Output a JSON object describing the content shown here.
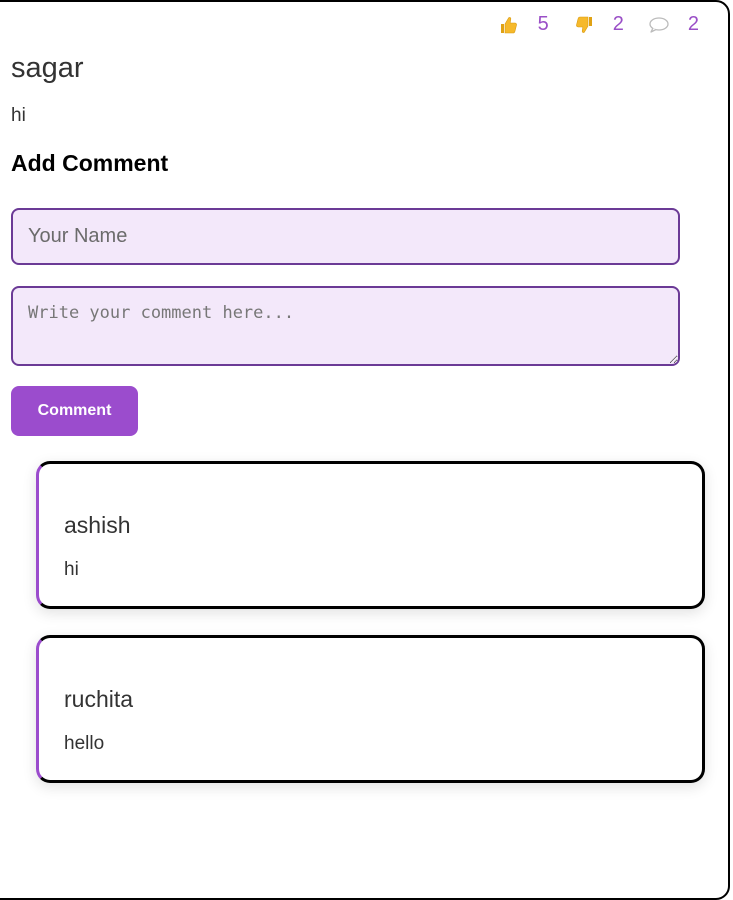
{
  "post": {
    "author": "sagar",
    "text": "hi",
    "reactions": {
      "likes": "5",
      "dislikes": "2",
      "comments": "2",
      "like_icon": "thumbs-up-icon",
      "dislike_icon": "thumbs-down-icon",
      "comment_icon": "speech-bubble-icon"
    }
  },
  "form": {
    "title": "Add Comment",
    "name_placeholder": "Your Name",
    "name_value": "",
    "comment_placeholder": "Write your comment here...",
    "comment_value": "",
    "submit_label": "Comment"
  },
  "comments": [
    {
      "author": "ashish",
      "text": "hi"
    },
    {
      "author": "ruchita",
      "text": "hello"
    }
  ],
  "colors": {
    "accent": "#9b4ccd",
    "input_background": "#f3e8fa",
    "input_border": "#6b3a96",
    "count_text": "#9a4fc7"
  }
}
